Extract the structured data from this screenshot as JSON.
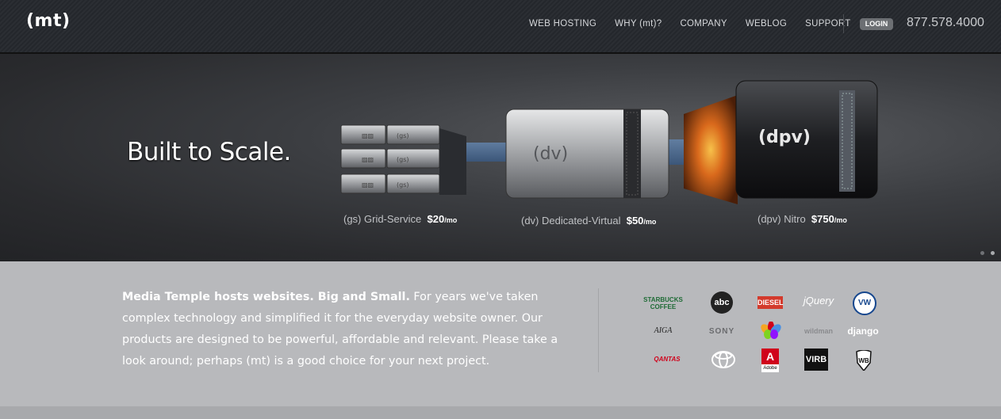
{
  "header": {
    "logo": "(mt)",
    "nav": [
      "WEB HOSTING",
      "WHY (mt)?",
      "COMPANY",
      "WEBLOG",
      "SUPPORT"
    ],
    "login_label": "LOGIN",
    "phone": "877.578.4000"
  },
  "hero": {
    "headline": "Built to Scale.",
    "products": [
      {
        "name": "(gs) Grid-Service",
        "price": "$20",
        "unit": "/mo",
        "badge": "(gs)"
      },
      {
        "name": "(dv) Dedicated-Virtual",
        "price": "$50",
        "unit": "/mo",
        "badge": "(dv)"
      },
      {
        "name": "(dpv) Nitro",
        "price": "$750",
        "unit": "/mo",
        "badge": "(dpv)"
      }
    ]
  },
  "intro": {
    "lead": "Media Temple hosts websites. Big and Small.",
    "body": " For years we've taken complex technology and simplified it for the everyday website owner. Our products are designed to be powerful, affordable and relevant. Please take a look around; perhaps (mt) is a good choice for your next project."
  },
  "clients": {
    "starbucks": "STARBUCKS COFFEE",
    "abc": "abc",
    "diesel": "DIESEL",
    "jquery": "jQuery",
    "vw": "VW",
    "aiga": "AIGA",
    "sony": "SONY",
    "nbc": "",
    "wildman": "wildman",
    "django": "django",
    "qantas": "QANTAS",
    "toyota": "",
    "adobe": "Adobe",
    "virb": "VIRB",
    "wb": "WB"
  }
}
